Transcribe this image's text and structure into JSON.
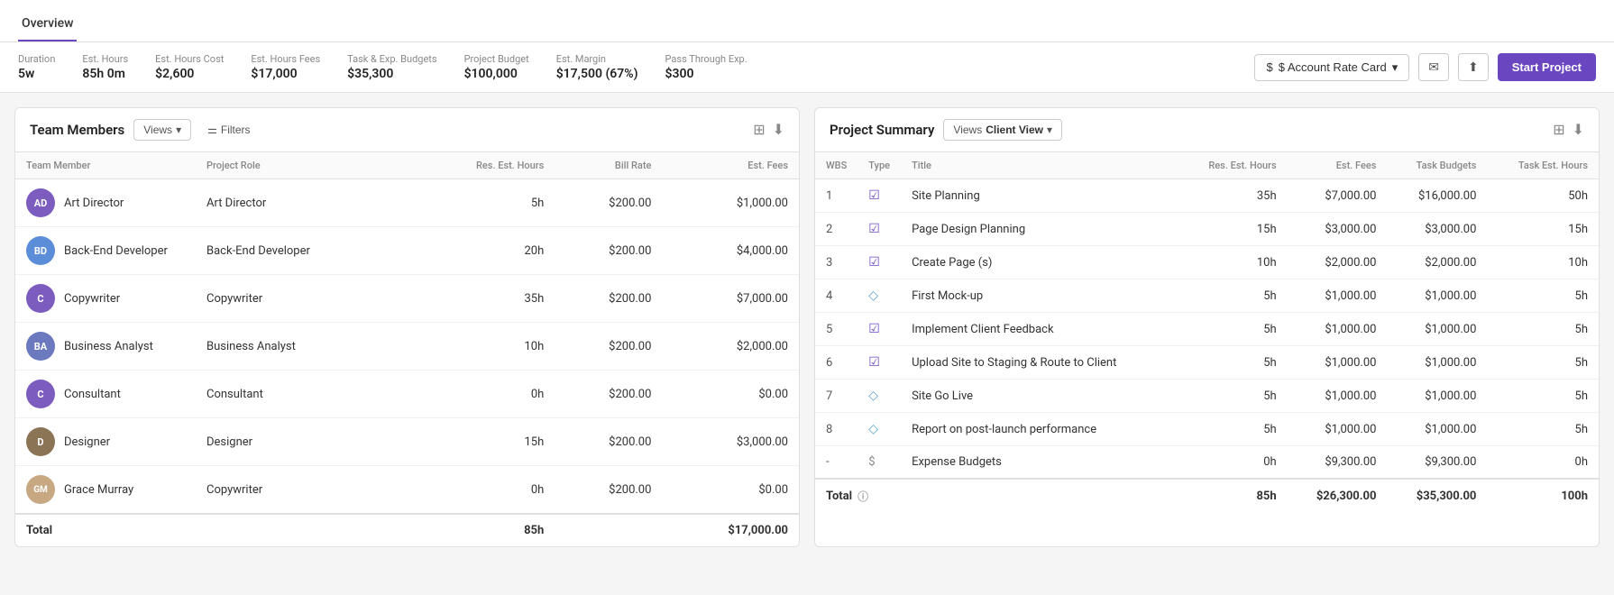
{
  "tabs": [
    {
      "label": "Overview",
      "active": true
    }
  ],
  "metrics": [
    {
      "label": "Duration",
      "value": "5w"
    },
    {
      "label": "Est. Hours",
      "value": "85h 0m"
    },
    {
      "label": "Est. Hours Cost",
      "value": "$2,600"
    },
    {
      "label": "Est. Hours Fees",
      "value": "$17,000"
    },
    {
      "label": "Task & Exp. Budgets",
      "value": "$35,300"
    },
    {
      "label": "Project Budget",
      "value": "$100,000"
    },
    {
      "label": "Est. Margin",
      "value": "$17,500 (67%)"
    },
    {
      "label": "Pass Through Exp.",
      "value": "$300"
    }
  ],
  "rateCardLabel": "$ Account Rate Card",
  "startProjectLabel": "Start Project",
  "teamPanel": {
    "title": "Team Members",
    "viewsLabel": "Views",
    "filtersLabel": "Filters",
    "columns": [
      "Team Member",
      "Project Role",
      "Res. Est. Hours",
      "Bill Rate",
      "Est. Fees"
    ],
    "members": [
      {
        "initials": "AD",
        "color": "#7c5cbf",
        "name": "Art Director",
        "role": "Art Director",
        "hours": "5h",
        "billRate": "$200.00",
        "fees": "$1,000.00"
      },
      {
        "initials": "BD",
        "color": "#7c5cbf",
        "name": "Back-End Developer",
        "role": "Back-End Developer",
        "hours": "20h",
        "billRate": "$200.00",
        "fees": "$4,000.00"
      },
      {
        "initials": "C",
        "color": "#7c5cbf",
        "name": "Copywriter",
        "role": "Copywriter",
        "hours": "35h",
        "billRate": "$200.00",
        "fees": "$7,000.00"
      },
      {
        "initials": "BA",
        "color": "#7c5cbf",
        "name": "Business Analyst",
        "role": "Business Analyst",
        "hours": "10h",
        "billRate": "$200.00",
        "fees": "$2,000.00"
      },
      {
        "initials": "C",
        "color": "#7c5cbf",
        "name": "Consultant",
        "role": "Consultant",
        "hours": "0h",
        "billRate": "$200.00",
        "fees": "$0.00"
      },
      {
        "initials": "D",
        "color": "#7c5cbf",
        "name": "Designer",
        "role": "Designer",
        "hours": "15h",
        "billRate": "$200.00",
        "fees": "$3,000.00"
      },
      {
        "initials": "GM",
        "color": null,
        "name": "Grace Murray",
        "role": "Copywriter",
        "hours": "0h",
        "billRate": "$200.00",
        "fees": "$0.00",
        "isPhoto": true
      }
    ],
    "total": {
      "label": "Total",
      "hours": "85h",
      "fees": "$17,000.00"
    }
  },
  "projectPanel": {
    "title": "Project Summary",
    "viewsLabel": "Views",
    "clientViewLabel": "Client View",
    "columns": [
      "WBS",
      "Type",
      "Title",
      "Res. Est. Hours",
      "Est. Fees",
      "Task Budgets",
      "Task Est. Hours"
    ],
    "rows": [
      {
        "wbs": "1",
        "type": "check",
        "title": "Site Planning",
        "resHours": "35h",
        "estFees": "$7,000.00",
        "taskBudgets": "$16,000.00",
        "taskHours": "50h"
      },
      {
        "wbs": "2",
        "type": "check",
        "title": "Page Design Planning",
        "resHours": "15h",
        "estFees": "$3,000.00",
        "taskBudgets": "$3,000.00",
        "taskHours": "15h"
      },
      {
        "wbs": "3",
        "type": "check",
        "title": "Create Page (s)",
        "resHours": "10h",
        "estFees": "$2,000.00",
        "taskBudgets": "$2,000.00",
        "taskHours": "10h"
      },
      {
        "wbs": "4",
        "type": "diamond",
        "title": "First Mock-up",
        "resHours": "5h",
        "estFees": "$1,000.00",
        "taskBudgets": "$1,000.00",
        "taskHours": "5h"
      },
      {
        "wbs": "5",
        "type": "check",
        "title": "Implement Client Feedback",
        "resHours": "5h",
        "estFees": "$1,000.00",
        "taskBudgets": "$1,000.00",
        "taskHours": "5h"
      },
      {
        "wbs": "6",
        "type": "check",
        "title": "Upload Site to Staging & Route to Client",
        "resHours": "5h",
        "estFees": "$1,000.00",
        "taskBudgets": "$1,000.00",
        "taskHours": "5h"
      },
      {
        "wbs": "7",
        "type": "diamond",
        "title": "Site Go Live",
        "resHours": "5h",
        "estFees": "$1,000.00",
        "taskBudgets": "$1,000.00",
        "taskHours": "5h"
      },
      {
        "wbs": "8",
        "type": "diamond",
        "title": "Report on post-launch performance",
        "resHours": "5h",
        "estFees": "$1,000.00",
        "taskBudgets": "$1,000.00",
        "taskHours": "5h"
      },
      {
        "wbs": "-",
        "type": "dollar",
        "title": "Expense Budgets",
        "resHours": "0h",
        "estFees": "$9,300.00",
        "taskBudgets": "$9,300.00",
        "taskHours": "0h"
      }
    ],
    "total": {
      "label": "Total",
      "resHours": "85h",
      "estFees": "$26,300.00",
      "taskBudgets": "$35,300.00",
      "taskHours": "100h"
    }
  },
  "avatarColors": {
    "AD": "#7c5cbf",
    "BD": "#6b9bd2",
    "C": "#7c5cbf",
    "BA": "#7c5cbf",
    "D": "#a0522d"
  }
}
